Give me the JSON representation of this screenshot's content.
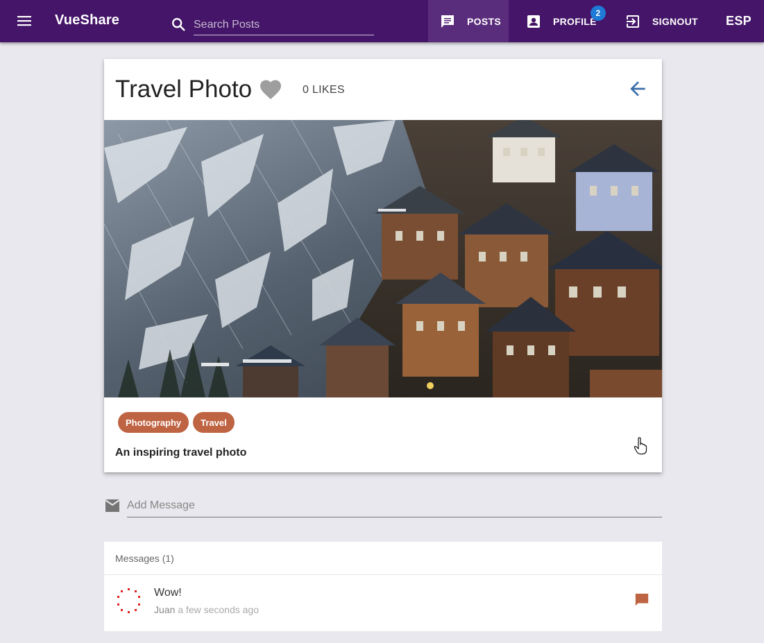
{
  "appbar": {
    "brand": "VueShare",
    "search_placeholder": "Search Posts",
    "nav": {
      "posts": "POSTS",
      "profile": "PROFILE",
      "profile_badge": "2",
      "signout": "SIGNOUT",
      "language": "ESP"
    },
    "colors": {
      "bar": "#441568",
      "active": "#5a2d7c",
      "badge": "#1e7ad6"
    }
  },
  "post": {
    "title": "Travel Photo",
    "likes": "0 LIKES",
    "categories": [
      "Photography",
      "Travel"
    ],
    "description": "An inspiring travel photo",
    "image_alt": "Alpine village houses on a snowy mountainside",
    "colors": {
      "chip": "#bf6443",
      "heart": "#9e9e9e",
      "back": "#3d6ea8"
    }
  },
  "message_form": {
    "placeholder": "Add Message"
  },
  "messages": {
    "header": "Messages (1)",
    "items": [
      {
        "text": "Wow!",
        "user": "Juan",
        "time": "a few seconds ago"
      }
    ]
  },
  "icons": [
    "menu-icon",
    "search-icon",
    "chat-icon",
    "profile-icon",
    "exit-icon",
    "heart-icon",
    "arrow-back-icon",
    "mail-icon",
    "comment-icon"
  ]
}
